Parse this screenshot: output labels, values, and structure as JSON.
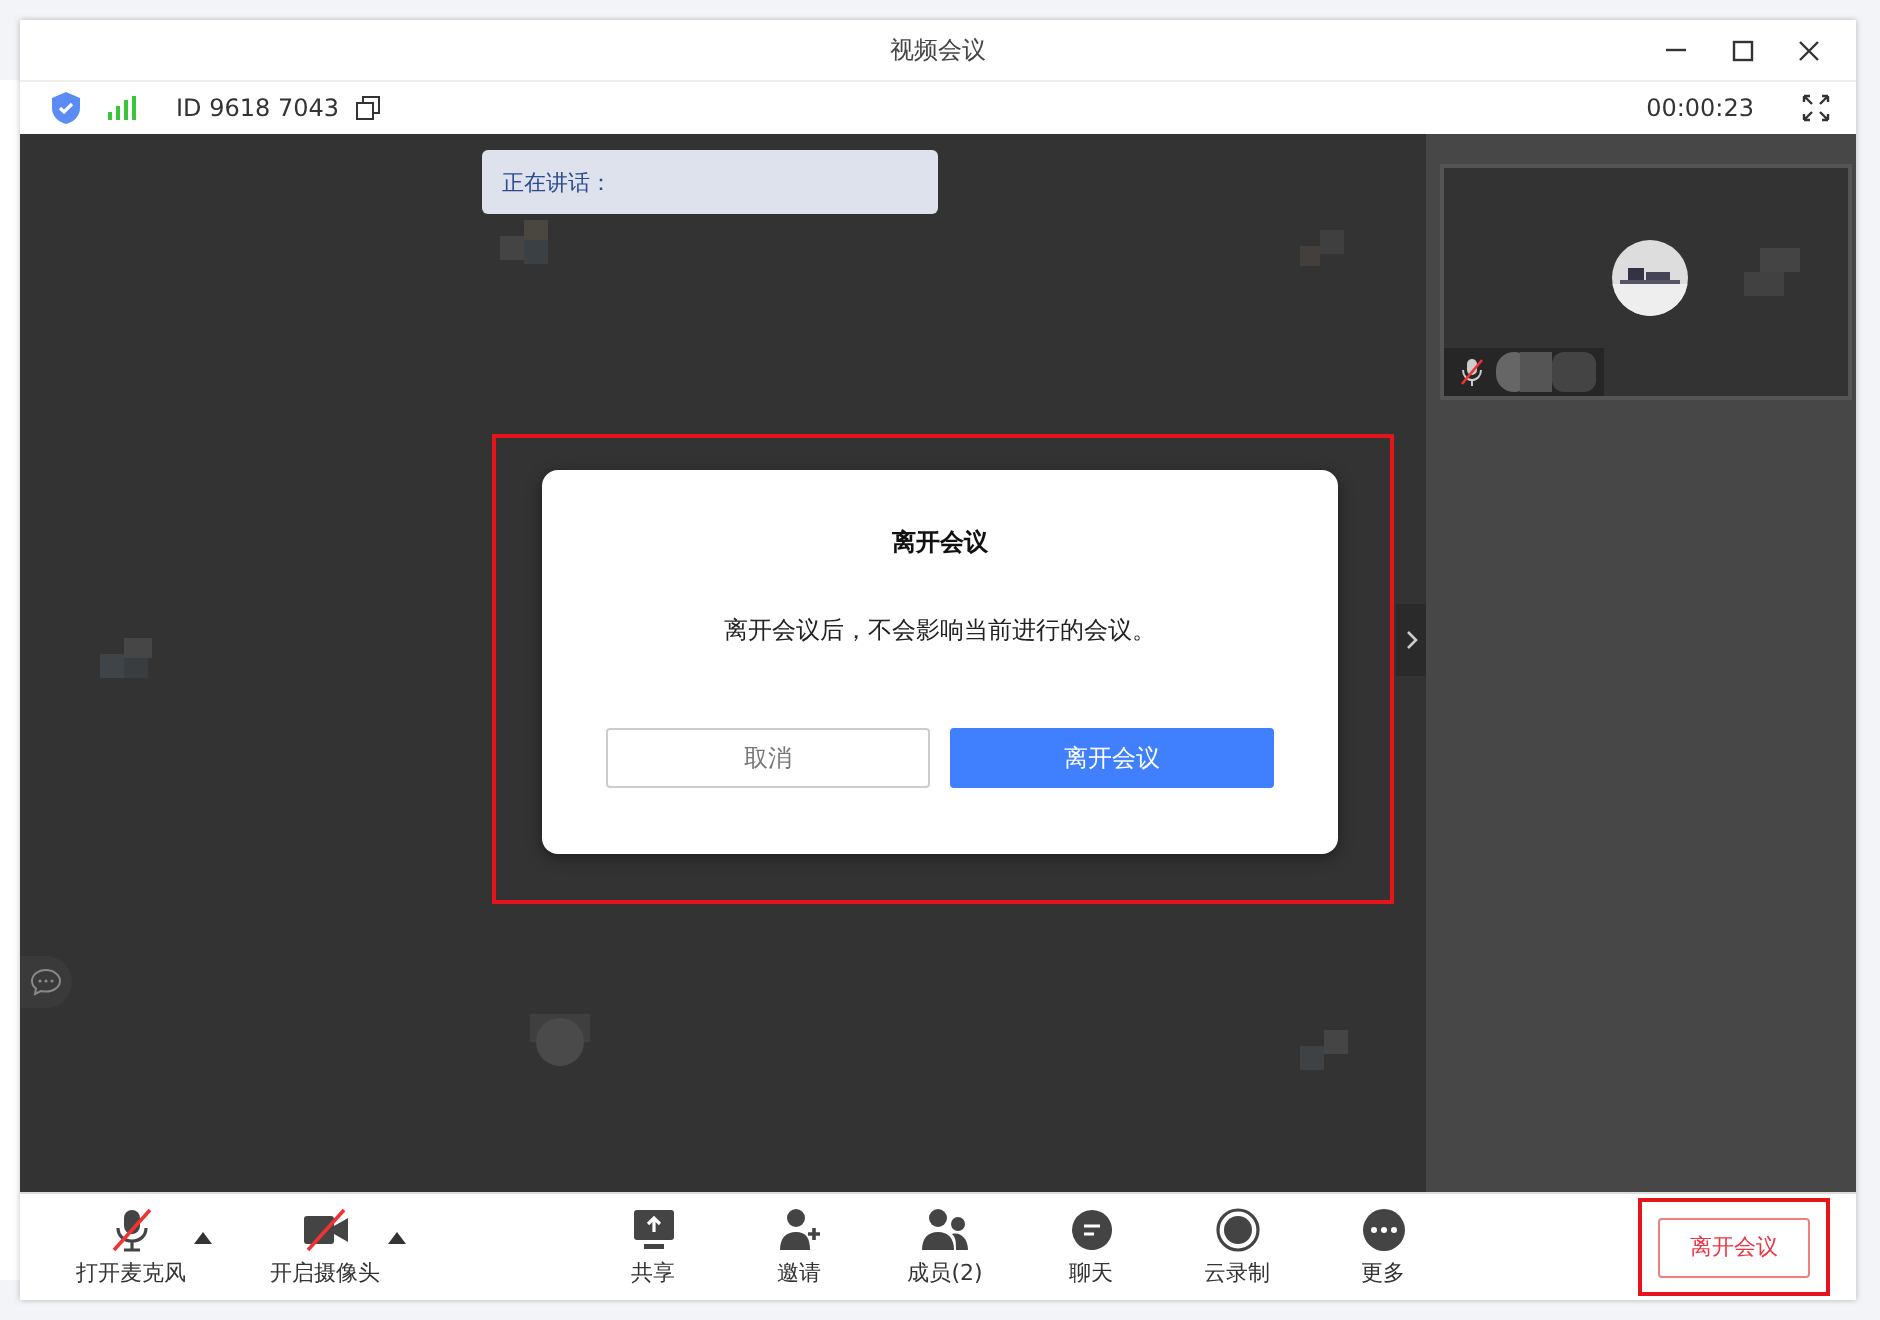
{
  "window": {
    "title": "视频会议"
  },
  "info_bar": {
    "meeting_id": "ID 9618 7043",
    "timer": "00:00:23"
  },
  "speaking": {
    "label": "正在讲话："
  },
  "participant": {
    "mic_on": false
  },
  "dialog": {
    "title": "离开会议",
    "message": "离开会议后，不会影响当前进行的会议。",
    "buttons": [
      {
        "label": "取消",
        "kind": "secondary"
      },
      {
        "label": "离开会议",
        "kind": "primary"
      }
    ]
  },
  "toolbar": {
    "devices": [
      {
        "label": "打开麦克风",
        "kind": "mic",
        "on": false
      },
      {
        "label": "开启摄像头",
        "kind": "camera",
        "on": false
      }
    ],
    "actions": [
      {
        "label": "共享",
        "kind": "share"
      },
      {
        "label": "邀请",
        "kind": "invite"
      },
      {
        "label": "成员(2)",
        "kind": "members"
      },
      {
        "label": "聊天",
        "kind": "chat"
      },
      {
        "label": "云录制",
        "kind": "record"
      },
      {
        "label": "更多",
        "kind": "more"
      }
    ],
    "leave_button": "离开会议"
  }
}
